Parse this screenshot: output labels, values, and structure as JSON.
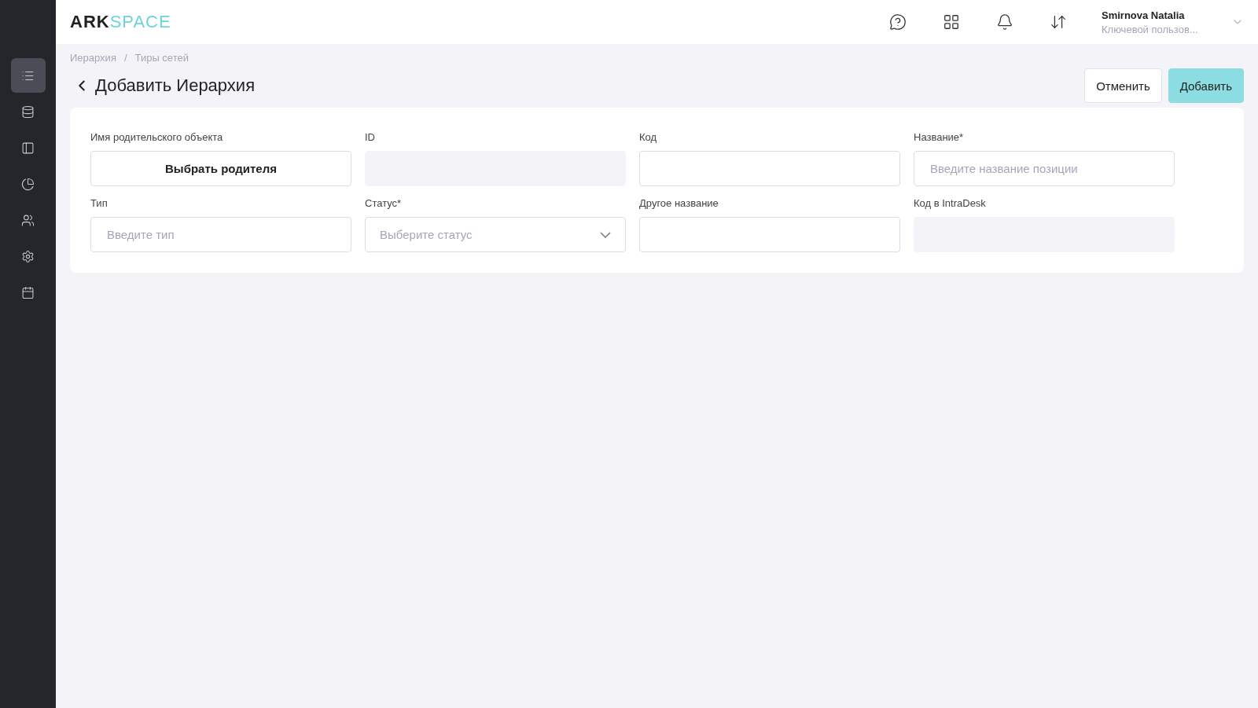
{
  "sidebar": {
    "items": [
      {
        "selected": true
      },
      {
        "selected": false
      },
      {
        "selected": false
      },
      {
        "selected": false
      },
      {
        "selected": false
      },
      {
        "selected": false
      },
      {
        "selected": false
      }
    ]
  },
  "header": {
    "logo": {
      "dark": "ARK",
      "light": "SPACE"
    },
    "user": {
      "name": "Smirnova Natalia",
      "role": "Ключевой пользов..."
    }
  },
  "breadcrumbs": [
    "Иерархия",
    "Тиры сетей"
  ],
  "breadcrumb_separator": "/",
  "title": "Добавить Иерархия",
  "actions": [
    {
      "label": "Отменить",
      "kind": "secondary"
    },
    {
      "label": "Добавить",
      "kind": "primary"
    }
  ],
  "fields": [
    {
      "label": "Имя родительского объекта",
      "kind": "button",
      "value": "Выбрать родителя"
    },
    {
      "label": "ID",
      "kind": "readonly"
    },
    {
      "label": "Код",
      "kind": "text"
    },
    {
      "label": "Название*",
      "kind": "text",
      "placeholder": "Введите название позиции"
    },
    {
      "label": "Тип",
      "kind": "text",
      "placeholder": "Введите тип"
    },
    {
      "label": "Статус*",
      "kind": "select",
      "placeholder": "Выберите статус"
    },
    {
      "label": "Другое название",
      "kind": "text"
    },
    {
      "label": "Код в IntraDesk",
      "kind": "readonly"
    }
  ]
}
